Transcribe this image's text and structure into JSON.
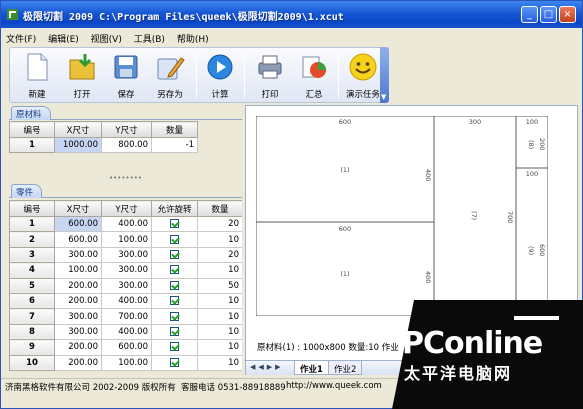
{
  "window": {
    "title": "极限切割 2009 C:\\Program Files\\queek\\极限切割2009\\1.xcut"
  },
  "menu": [
    "文件(F)",
    "编辑(E)",
    "视图(V)",
    "工具(B)",
    "帮助(H)"
  ],
  "toolbar": [
    {
      "label": "新建",
      "icon": "new-file-icon"
    },
    {
      "label": "打开",
      "icon": "open-folder-icon"
    },
    {
      "label": "保存",
      "icon": "floppy-save-icon"
    },
    {
      "label": "另存为",
      "icon": "save-as-icon"
    },
    {
      "label": "计算",
      "icon": "play-calculate-icon"
    },
    {
      "label": "打印",
      "icon": "printer-icon"
    },
    {
      "label": "汇总",
      "icon": "pie-summary-icon"
    },
    {
      "label": "演示任务",
      "icon": "smiley-demo-icon"
    }
  ],
  "raw_panel": {
    "tab": "原材料",
    "headers": [
      "编号",
      "X尺寸",
      "Y尺寸",
      "数量"
    ],
    "rows": [
      [
        "1",
        "1000.00",
        "800.00",
        "-1"
      ]
    ]
  },
  "parts_panel": {
    "tab": "零件",
    "headers": [
      "编号",
      "X尺寸",
      "Y尺寸",
      "允许旋转",
      "数量"
    ],
    "rows": [
      [
        "1",
        "600.00",
        "400.00",
        true,
        "20"
      ],
      [
        "2",
        "600.00",
        "100.00",
        true,
        "10"
      ],
      [
        "3",
        "300.00",
        "300.00",
        true,
        "20"
      ],
      [
        "4",
        "100.00",
        "300.00",
        true,
        "10"
      ],
      [
        "5",
        "200.00",
        "300.00",
        true,
        "50"
      ],
      [
        "6",
        "200.00",
        "400.00",
        true,
        "10"
      ],
      [
        "7",
        "300.00",
        "700.00",
        true,
        "10"
      ],
      [
        "8",
        "300.00",
        "400.00",
        true,
        "10"
      ],
      [
        "9",
        "200.00",
        "600.00",
        true,
        "10"
      ],
      [
        "10",
        "200.00",
        "100.00",
        true,
        "10"
      ]
    ]
  },
  "drawing": {
    "dims": [
      "600",
      "400",
      "600",
      "400",
      "300",
      "700",
      "100",
      "200",
      "100",
      "600"
    ],
    "ids": [
      "(1)",
      "(1)",
      "(7)",
      "(8)",
      "(9)"
    ]
  },
  "info": "原材料(1) : 1000x800  数量:10  作业",
  "sheet_tabs": [
    "作业1",
    "作业2"
  ],
  "status": {
    "company": "济南黑格软件有限公司 2002-2009 版权所有",
    "phone": "客服电话 0531-88918889",
    "url": "http://www.queek.com"
  },
  "watermark": {
    "logo": "PConline",
    "sub": "太平洋电脑网"
  }
}
